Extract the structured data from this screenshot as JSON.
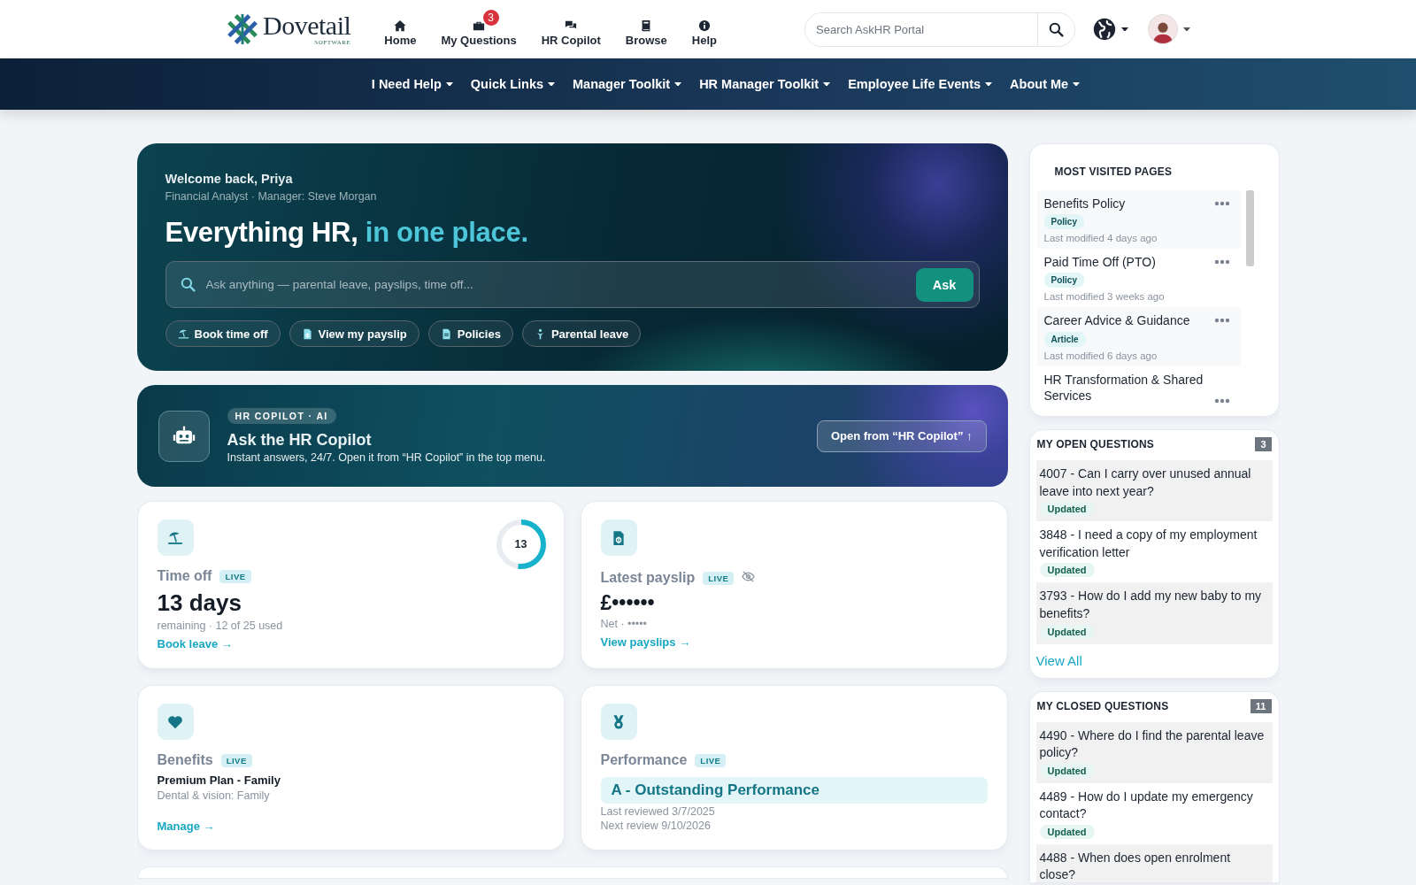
{
  "header": {
    "logo": {
      "name": "Dovetail",
      "tagline": "SOFTWARE"
    },
    "nav": [
      {
        "label": "Home"
      },
      {
        "label": "My Questions",
        "badge": "3"
      },
      {
        "label": "HR Copilot"
      },
      {
        "label": "Browse"
      },
      {
        "label": "Help"
      }
    ],
    "search": {
      "placeholder": "Search AskHR Portal"
    }
  },
  "menu": [
    {
      "label": "I Need Help"
    },
    {
      "label": "Quick Links"
    },
    {
      "label": "Manager Toolkit"
    },
    {
      "label": "HR Manager Toolkit"
    },
    {
      "label": "Employee Life Events"
    },
    {
      "label": "About Me"
    }
  ],
  "hero": {
    "greeting": "Welcome back, Priya",
    "subtitle": "Financial Analyst · Manager: Steve Morgan",
    "headline": "Everything HR, ",
    "headline_accent": "in one place.",
    "ask": {
      "placeholder": "Ask anything — parental leave, payslips, time off...",
      "button": "Ask"
    },
    "chips": [
      {
        "label": "Book time off"
      },
      {
        "label": "View my payslip"
      },
      {
        "label": "Policies"
      },
      {
        "label": "Parental leave"
      }
    ]
  },
  "copilot": {
    "tag": "HR COPILOT · AI",
    "title": "Ask the HR Copilot",
    "text": "Instant answers, 24/7. Open it from “HR Copilot” in the top menu.",
    "button": "Open from “HR Copilot” ↑"
  },
  "cards": [
    {
      "kind": "timeoff",
      "title": "Time off",
      "badge": "LIVE",
      "value": "13 days",
      "note": "remaining · 12 of 25 used",
      "link": "Book leave →",
      "ring_label": "13",
      "level": 0.52
    },
    {
      "kind": "payslip",
      "title": "Latest payslip",
      "badge": "LIVE",
      "hidden": true,
      "value": "£••••••",
      "note": "Net · •••••",
      "link": "View payslips →"
    },
    {
      "kind": "benefits",
      "title": "Benefits",
      "badge": "LIVE",
      "plan": "Premium Plan - Family",
      "note": "Dental & vision: Family",
      "link": "Manage →"
    },
    {
      "kind": "performance",
      "title": "Performance",
      "badge": "LIVE",
      "rating": "A - Outstanding Performance",
      "lines": [
        "Last reviewed 3/7/2025",
        "Next review 9/10/2026"
      ]
    }
  ],
  "most_visited": {
    "title": "MOST VISITED PAGES",
    "items": [
      {
        "title": "Benefits Policy",
        "tag": "Policy",
        "modified": "Last modified 4 days ago"
      },
      {
        "title": "Paid Time Off (PTO)",
        "tag": "Policy",
        "modified": "Last modified 3 weeks ago"
      },
      {
        "title": "Career Advice & Guidance",
        "tag": "Article",
        "modified": "Last modified 6 days ago"
      },
      {
        "title": "HR Transformation & Shared Services"
      }
    ]
  },
  "open_questions": {
    "title": "MY OPEN QUESTIONS",
    "count": "3",
    "items": [
      {
        "text": "4007 - Can I carry over unused annual leave into next year?",
        "status": "Updated"
      },
      {
        "text": "3848 - I need a copy of my employment verification letter",
        "status": "Updated"
      },
      {
        "text": "3793 - How do I add my new baby to my benefits?",
        "status": "Updated"
      }
    ],
    "link": "View All"
  },
  "closed_questions": {
    "title": "MY CLOSED QUESTIONS",
    "count": "11",
    "items": [
      {
        "text": "4490 - Where do I find the parental leave policy?",
        "status": "Updated"
      },
      {
        "text": "4489 - How do I update my emergency contact?",
        "status": "Updated"
      },
      {
        "text": "4488 - When does open enrolment close?"
      }
    ]
  }
}
